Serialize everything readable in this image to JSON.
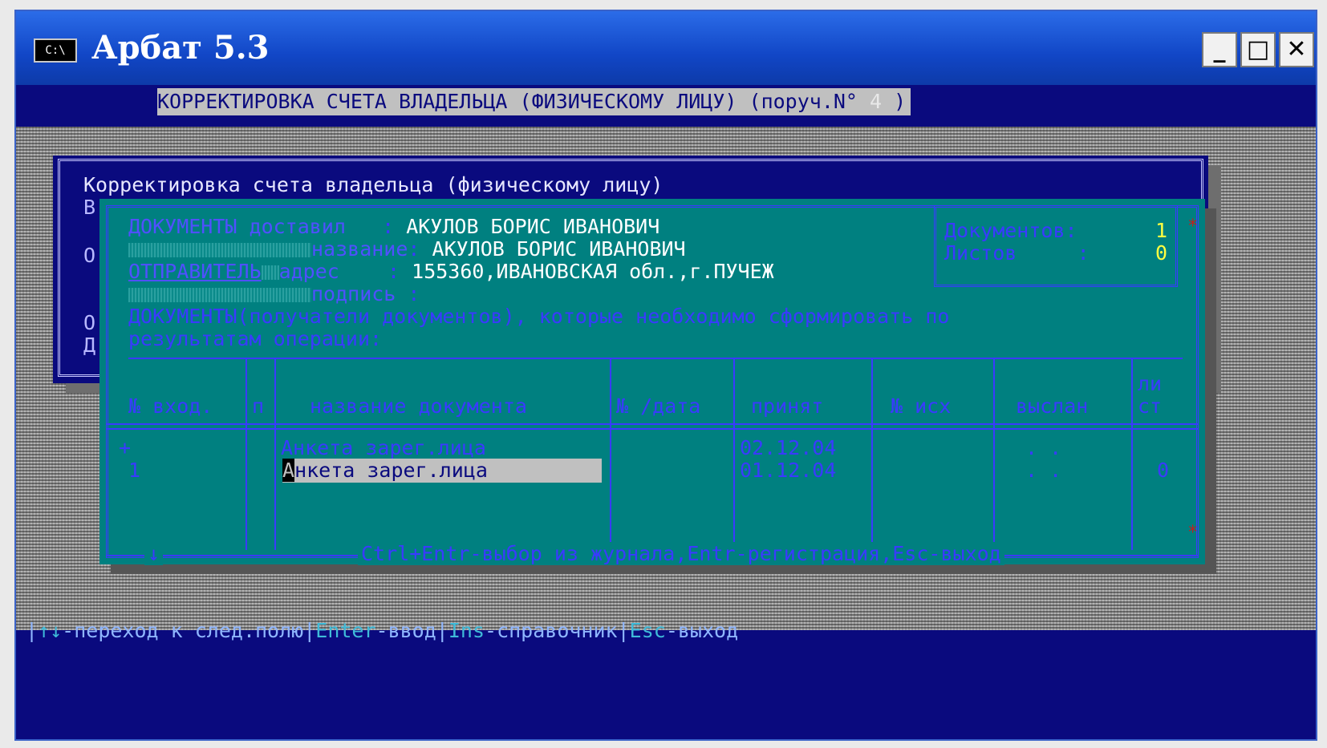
{
  "window": {
    "title": "Арбат 5.3",
    "icon_label": "C:\\",
    "minimize": "_",
    "maximize": "□",
    "close": "✕"
  },
  "header": {
    "title": "КОРРЕКТИРОВКА СЧЕТА ВЛАДЕЛЬЦА (ФИЗИЧЕСКОМУ ЛИЦУ) (поруч.N°",
    "order_number": "4",
    "close_paren": " )"
  },
  "back_dialog": {
    "title": "Корректировка счета владельца (физическому лицу)",
    "stubs": [
      "В",
      "О",
      "О",
      "Д"
    ]
  },
  "documents_dialog": {
    "delivered_label": "ДОКУМЕНТЫ доставил",
    "delivered_value": "АКУЛОВ БОРИС ИВАНОВИЧ",
    "name_label": "название",
    "name_value": "АКУЛОВ БОРИС ИВАНОВИЧ",
    "sender_label": "ОТПРАВИТЕЛЬ",
    "address_label": "адрес",
    "address_value": "155360,ИВАНОВСКАЯ обл.,г.ПУЧЕЖ",
    "signature_label": "подпись",
    "info_line1": "ДОКУМЕНТЫ(получатели документов), которые необходимо сформировать по",
    "info_line2": "результатам операции:",
    "counts": {
      "documents_label": "Документов:",
      "documents_value": "1",
      "sheets_label": "Листов     :",
      "sheets_value": "0"
    },
    "columns": {
      "num_in": "№ вход.",
      "p": "п",
      "doc_name": "название документа",
      "num_date": "№ /дата",
      "accepted": "принят",
      "num_out": "№ исх",
      "sent": "выслан",
      "sheets_top": "ли",
      "sheets_bottom": "ст"
    },
    "rows": [
      {
        "marker": "+",
        "doc_name": "Анкета зарег.лица",
        "accepted": "02.12.04",
        "sent": ". .",
        "sheets": ""
      },
      {
        "marker": "1",
        "doc_name_cursor": "А",
        "doc_name": "нкета зарег.лица",
        "accepted": "01.12.04",
        "sent": ". .",
        "sheets": "0"
      }
    ],
    "footer": "Ctrl+Entr-выбор из журнала,Entr-регистрация,Esc-выход",
    "scroll_arrow": "↓"
  },
  "statusbar": {
    "arrows_key": "↑↓",
    "arrows_text": "-переход к след.полю",
    "enter_key": "Enter",
    "enter_text": "-ввод",
    "ins_key": "Ins",
    "ins_text": "-справочник",
    "esc_key": "Esc",
    "esc_text": "-выход"
  },
  "colors": {
    "console_bg": "#0a0a7e",
    "dialog_bg": "#008080",
    "dialog_fg": "#3a3aff",
    "value_fg": "#ffffff",
    "count_fg": "#ffff40",
    "titlebar": "#1146c6"
  }
}
